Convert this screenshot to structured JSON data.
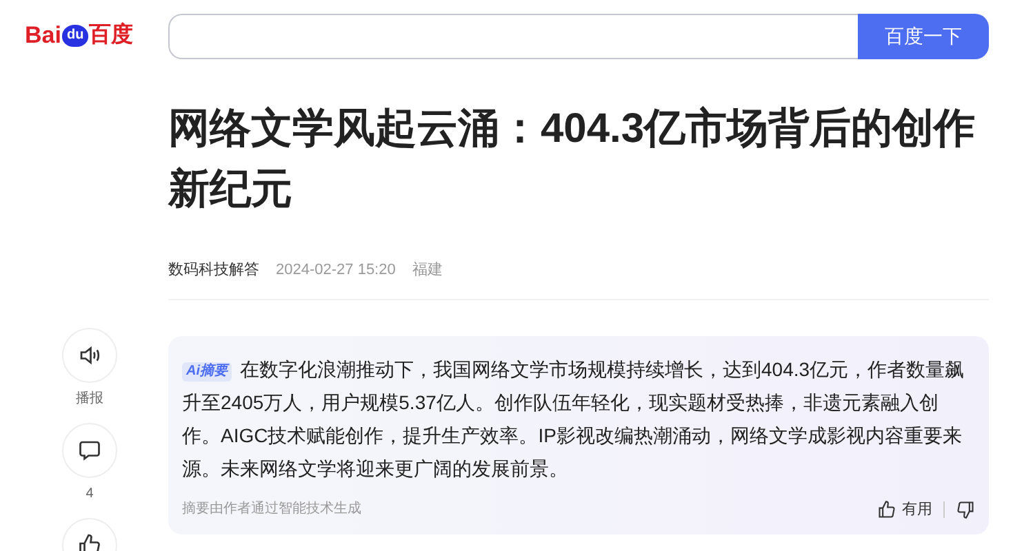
{
  "logo": {
    "parts": [
      "Bai",
      "du",
      "百度"
    ]
  },
  "search": {
    "button": "百度一下"
  },
  "article": {
    "title": "网络文学风起云涌：404.3亿市场背后的创作新纪元",
    "author": "数码科技解答",
    "time": "2024-02-27 15:20",
    "location": "福建"
  },
  "rail": [
    {
      "kind": "speaker",
      "label": "播报"
    },
    {
      "kind": "comment",
      "label": "4"
    },
    {
      "kind": "like"
    }
  ],
  "summary": {
    "badge": "Ai摘要",
    "text": "在数字化浪潮推动下，我国网络文学市场规模持续增长，达到404.3亿元，作者数量飙升至2405万人，用户规模5.37亿人。创作队伍年轻化，现实题材受热捧，非遗元素融入创作。AIGC技术赋能创作，提升生产效率。IP影视改编热潮涌动，网络文学成影视内容重要来源。未来网络文学将迎来更广阔的发展前景。",
    "note": "摘要由作者通过智能技术生成",
    "useful": "有用"
  }
}
